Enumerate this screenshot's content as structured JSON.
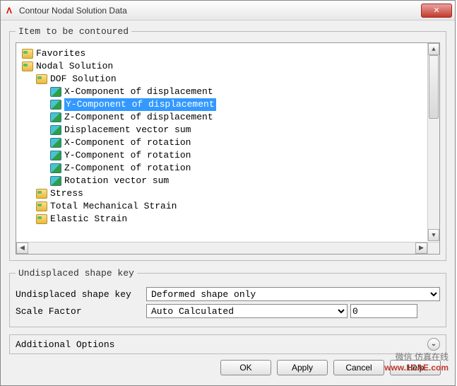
{
  "window": {
    "title": "Contour Nodal Solution Data",
    "app_icon": "Λ",
    "close_icon": "✕"
  },
  "group1": {
    "legend": "Item to be contoured"
  },
  "tree": {
    "items": [
      {
        "indent": 0,
        "icon": "folder",
        "label": "Favorites",
        "selected": false
      },
      {
        "indent": 0,
        "icon": "folder",
        "label": "Nodal Solution",
        "selected": false
      },
      {
        "indent": 1,
        "icon": "folder",
        "label": "DOF Solution",
        "selected": false
      },
      {
        "indent": 2,
        "icon": "cube",
        "label": "X-Component of displacement",
        "selected": false
      },
      {
        "indent": 2,
        "icon": "cube",
        "label": "Y-Component of displacement",
        "selected": true
      },
      {
        "indent": 2,
        "icon": "cube",
        "label": "Z-Component of displacement",
        "selected": false
      },
      {
        "indent": 2,
        "icon": "cube",
        "label": "Displacement vector sum",
        "selected": false
      },
      {
        "indent": 2,
        "icon": "cube",
        "label": "X-Component of rotation",
        "selected": false
      },
      {
        "indent": 2,
        "icon": "cube",
        "label": "Y-Component of rotation",
        "selected": false
      },
      {
        "indent": 2,
        "icon": "cube",
        "label": "Z-Component of rotation",
        "selected": false
      },
      {
        "indent": 2,
        "icon": "cube",
        "label": "Rotation vector sum",
        "selected": false
      },
      {
        "indent": 1,
        "icon": "folder",
        "label": "Stress",
        "selected": false
      },
      {
        "indent": 1,
        "icon": "folder",
        "label": "Total Mechanical Strain",
        "selected": false
      },
      {
        "indent": 1,
        "icon": "folder",
        "label": "Elastic Strain",
        "selected": false
      }
    ]
  },
  "group2": {
    "legend": "Undisplaced shape key",
    "row1_label": "Undisplaced shape key",
    "row1_value": "Deformed shape only",
    "row2_label": "Scale Factor",
    "row2_value": "Auto Calculated",
    "row2_input": "0"
  },
  "expander": {
    "label": "Additional Options",
    "icon": "⌄"
  },
  "buttons": {
    "ok": "OK",
    "apply": "Apply",
    "cancel": "Cancel",
    "help": "Help"
  },
  "scroll": {
    "up": "▲",
    "down": "▼",
    "left": "◀",
    "right": "▶"
  },
  "watermark": {
    "line1": "微信 仿真在线",
    "line2": "www.1CAE.com"
  }
}
